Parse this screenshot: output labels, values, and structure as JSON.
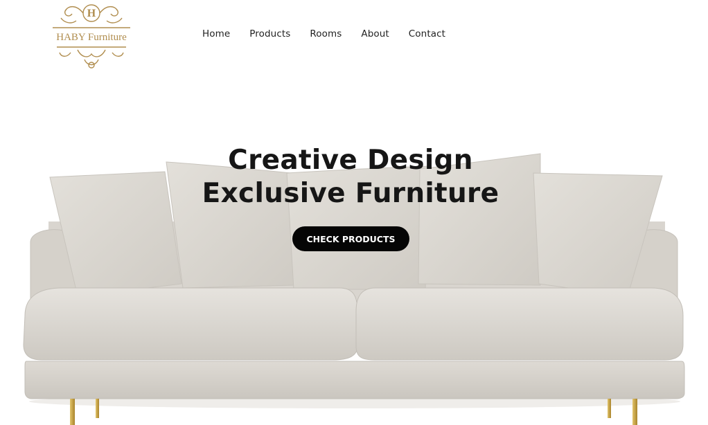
{
  "brand": {
    "name": "HABY Furniture",
    "monogram": "H"
  },
  "nav": {
    "items": [
      "Home",
      "Products",
      "Rooms",
      "About",
      "Contact"
    ]
  },
  "hero": {
    "title_line1": "Creative Design",
    "title_line2": "Exclusive Furniture",
    "cta_label": "CHECK PRODUCTS"
  },
  "colors": {
    "brand_gold": "#b08d4e",
    "cta_bg": "#050505",
    "sofa_fabric": "#dcd8d2",
    "leg_brass": "#c9a13b"
  }
}
